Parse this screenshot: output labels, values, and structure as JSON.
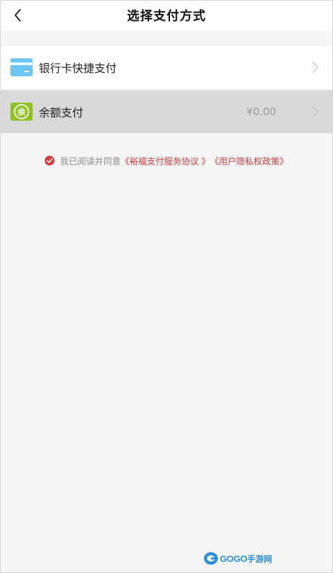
{
  "header": {
    "title": "选择支付方式",
    "back_icon": "chevron-left-icon"
  },
  "payment_methods": [
    {
      "label": "银行卡快捷支付",
      "icon": "bank-card-icon",
      "icon_color": "#6ec6f5",
      "selected": false
    },
    {
      "label": "余额支付",
      "icon": "balance-icon",
      "icon_glyph": "余",
      "icon_color": "#8dc21f",
      "amount": "¥0.00",
      "selected": true
    }
  ],
  "agreement": {
    "checked": true,
    "text": "我已阅读并同意",
    "link_1": "《裕福支付服务协议 》",
    "link_2": "《用户隐私权政策》",
    "link_color": "#d23b3b"
  },
  "watermark": {
    "brand": "GOGO",
    "suffix": "手游网"
  }
}
